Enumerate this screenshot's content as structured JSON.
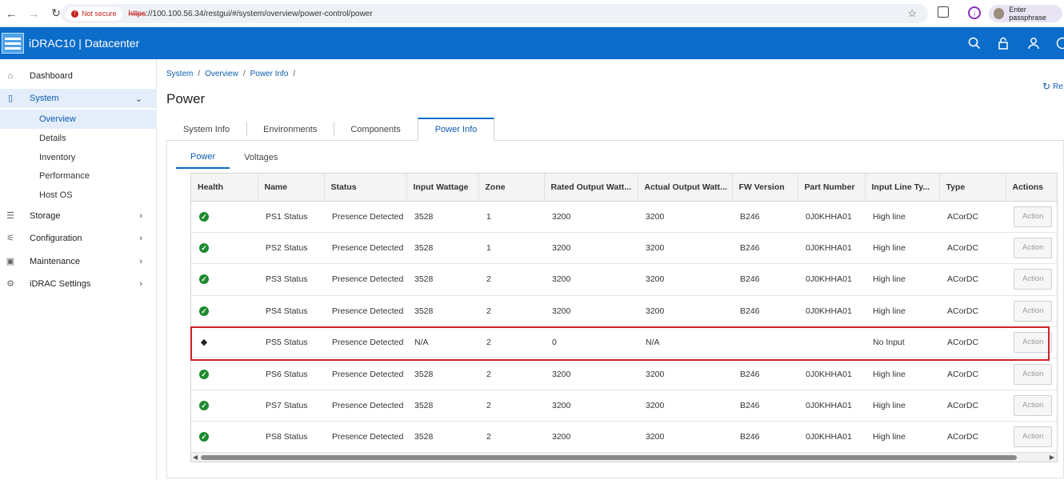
{
  "browser": {
    "security_label": "Not secure",
    "url_scheme": "https",
    "url_rest": "://100.100.56.34/restgui/#/system/overview/power-control/power",
    "profile_label": "Enter passphrase"
  },
  "app": {
    "title": "iDRAC10 | Datacenter"
  },
  "sidebar": {
    "items": [
      {
        "label": "Dashboard",
        "icon": "home-icon"
      },
      {
        "label": "System",
        "icon": "server-icon"
      },
      {
        "label": "Storage",
        "icon": "database-icon"
      },
      {
        "label": "Configuration",
        "icon": "sliders-icon"
      },
      {
        "label": "Maintenance",
        "icon": "maintenance-icon"
      },
      {
        "label": "iDRAC Settings",
        "icon": "settings-icon"
      }
    ],
    "system_sub": [
      "Overview",
      "Details",
      "Inventory",
      "Performance",
      "Host OS"
    ]
  },
  "breadcrumb": [
    "System",
    "Overview",
    "Power Info"
  ],
  "refresh_label": "Re",
  "page_title": "Power",
  "tabs": [
    "System Info",
    "Environments",
    "Components",
    "Power Info"
  ],
  "subtabs": [
    "Power",
    "Voltages"
  ],
  "table": {
    "columns": [
      "Health",
      "Name",
      "Status",
      "Input Wattage",
      "Zone",
      "Rated Output Watt...",
      "Actual Output Watt...",
      "FW Version",
      "Part Number",
      "Input Line Ty...",
      "Type",
      "Actions"
    ],
    "action_label": "Action",
    "rows": [
      {
        "health": "ok",
        "name": "PS1 Status",
        "status": "Presence Detected",
        "input_wattage": "3528",
        "zone": "1",
        "rated": "3200",
        "actual": "3200",
        "fw": "B246",
        "part": "0J0KHHA01",
        "line": "High line",
        "type": "ACorDC"
      },
      {
        "health": "ok",
        "name": "PS2 Status",
        "status": "Presence Detected",
        "input_wattage": "3528",
        "zone": "1",
        "rated": "3200",
        "actual": "3200",
        "fw": "B246",
        "part": "0J0KHHA01",
        "line": "High line",
        "type": "ACorDC"
      },
      {
        "health": "ok",
        "name": "PS3 Status",
        "status": "Presence Detected",
        "input_wattage": "3528",
        "zone": "2",
        "rated": "3200",
        "actual": "3200",
        "fw": "B246",
        "part": "0J0KHHA01",
        "line": "High line",
        "type": "ACorDC"
      },
      {
        "health": "ok",
        "name": "PS4 Status",
        "status": "Presence Detected",
        "input_wattage": "3528",
        "zone": "2",
        "rated": "3200",
        "actual": "3200",
        "fw": "B246",
        "part": "0J0KHHA01",
        "line": "High line",
        "type": "ACorDC"
      },
      {
        "health": "unknown",
        "name": "PS5 Status",
        "status": "Presence Detected",
        "input_wattage": "N/A",
        "zone": "2",
        "rated": "0",
        "actual": "N/A",
        "fw": "",
        "part": "",
        "line": "No Input",
        "type": "ACorDC"
      },
      {
        "health": "ok",
        "name": "PS6 Status",
        "status": "Presence Detected",
        "input_wattage": "3528",
        "zone": "2",
        "rated": "3200",
        "actual": "3200",
        "fw": "B246",
        "part": "0J0KHHA01",
        "line": "High line",
        "type": "ACorDC"
      },
      {
        "health": "ok",
        "name": "PS7 Status",
        "status": "Presence Detected",
        "input_wattage": "3528",
        "zone": "2",
        "rated": "3200",
        "actual": "3200",
        "fw": "B246",
        "part": "0J0KHHA01",
        "line": "High line",
        "type": "ACorDC"
      },
      {
        "health": "ok",
        "name": "PS8 Status",
        "status": "Presence Detected",
        "input_wattage": "3528",
        "zone": "2",
        "rated": "3200",
        "actual": "3200",
        "fw": "B246",
        "part": "0J0KHHA01",
        "line": "High line",
        "type": "ACorDC"
      }
    ]
  },
  "colors": {
    "header_blue": "#0b6cc9",
    "ok_green": "#1d8a2f",
    "highlight_red": "#d0202a"
  }
}
